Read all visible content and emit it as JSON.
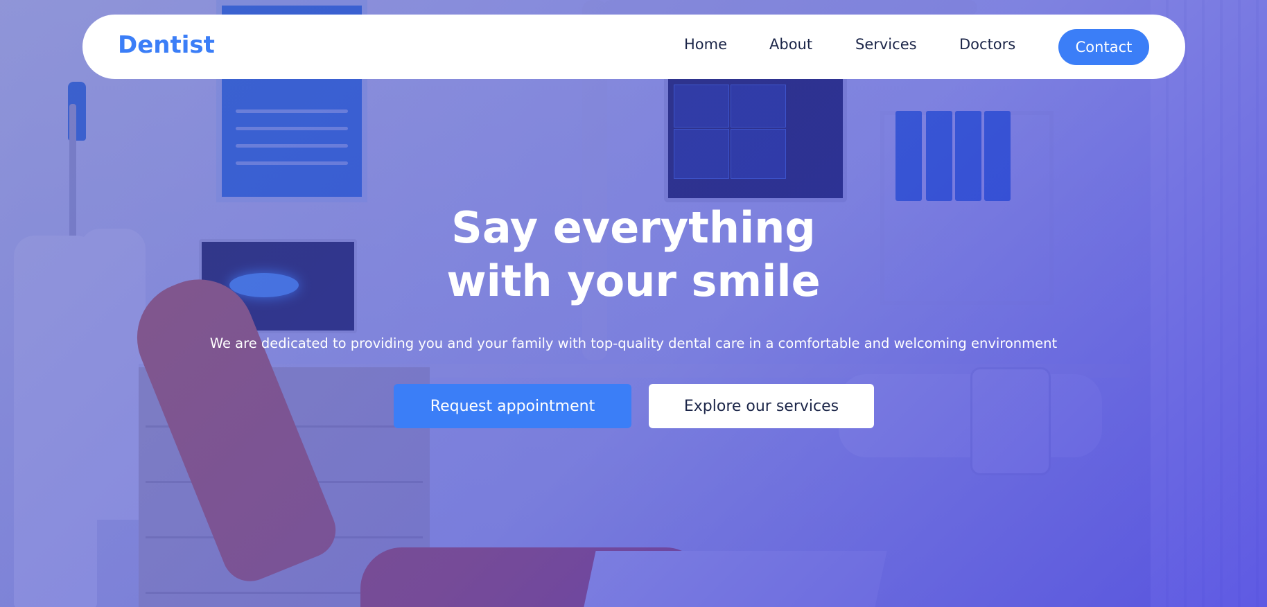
{
  "brand": {
    "name": "Dentist",
    "accent": "#3b7ef7"
  },
  "nav": {
    "items": [
      {
        "label": "Home"
      },
      {
        "label": "About"
      },
      {
        "label": "Services"
      },
      {
        "label": "Doctors"
      }
    ],
    "contact_label": "Contact"
  },
  "hero": {
    "headline_line1": "Say everything",
    "headline_line2": "with your smile",
    "subtitle": "We are dedicated to providing you and your family with top-quality dental care in a comfortable and welcoming environment",
    "primary_cta": "Request appointment",
    "secondary_cta": "Explore our services",
    "background": "dental-clinic-photo"
  }
}
